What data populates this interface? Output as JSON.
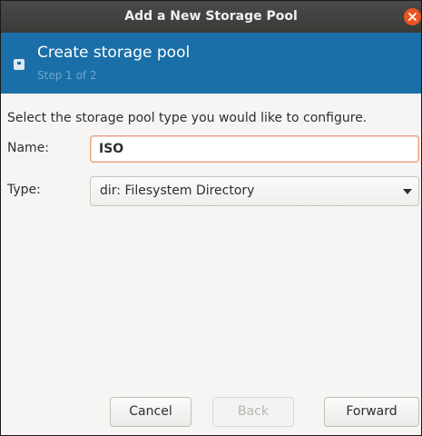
{
  "window": {
    "title": "Add a New Storage Pool"
  },
  "header": {
    "title": "Create storage pool",
    "step": "Step 1 of 2"
  },
  "form": {
    "instruction": "Select the storage pool type you would like to configure.",
    "name_label": "Name:",
    "name_value": "ISO",
    "type_label": "Type:",
    "type_value": "dir: Filesystem Directory"
  },
  "buttons": {
    "cancel": "Cancel",
    "back": "Back",
    "forward": "Forward"
  },
  "colors": {
    "header_band": "#1a6fa8",
    "close_button": "#e95420",
    "focus_border": "#e9a07f"
  }
}
